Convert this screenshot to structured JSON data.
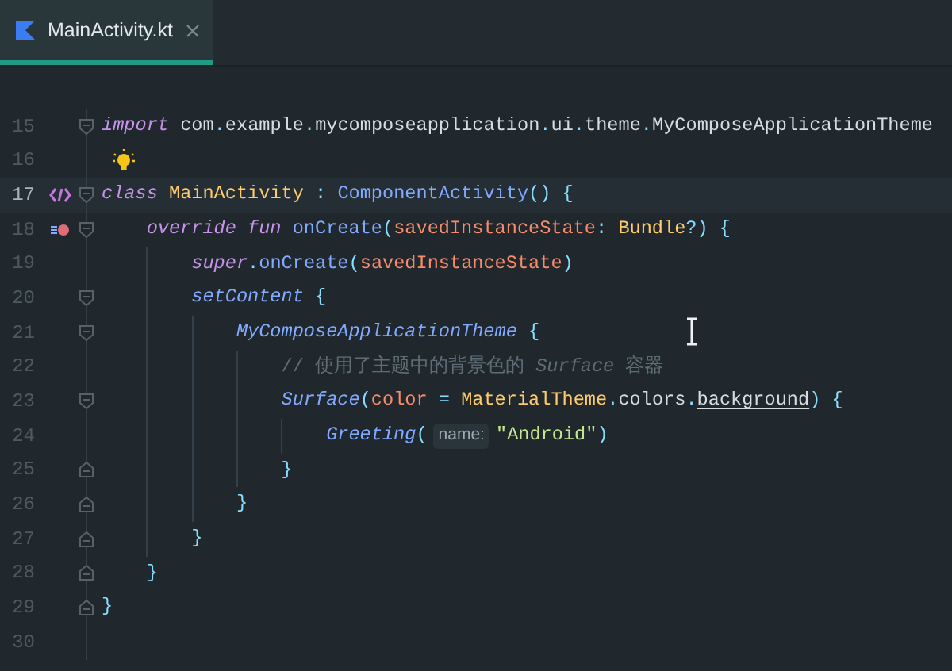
{
  "tabs": [
    {
      "label": "MainActivity.kt",
      "selected": true
    }
  ],
  "lines": [
    {
      "number": "15",
      "current": false,
      "fold": {
        "kind": "start"
      },
      "tokens": [
        {
          "kind": "kw",
          "text": "import"
        },
        {
          "kind": "plain",
          "text": " com"
        },
        {
          "kind": "punct",
          "text": "."
        },
        {
          "kind": "plain",
          "text": "example"
        },
        {
          "kind": "punct",
          "text": "."
        },
        {
          "kind": "plain",
          "text": "mycomposeapplication"
        },
        {
          "kind": "punct",
          "text": "."
        },
        {
          "kind": "plain",
          "text": "ui"
        },
        {
          "kind": "punct",
          "text": "."
        },
        {
          "kind": "plain",
          "text": "theme"
        },
        {
          "kind": "punct",
          "text": "."
        },
        {
          "kind": "plain",
          "text": "MyComposeApplicationTheme"
        }
      ]
    },
    {
      "number": "16",
      "current": false,
      "marker": {
        "kind": "bulb"
      }
    },
    {
      "number": "17",
      "current": true,
      "fold": {
        "kind": "start"
      },
      "marker": {
        "kind": "implemented"
      },
      "tokens": [
        {
          "kind": "kw",
          "text": "class"
        },
        {
          "kind": "cls",
          "text": " MainActivity"
        },
        {
          "kind": "punct",
          "text": " :"
        },
        {
          "kind": "type",
          "text": " ComponentActivity"
        },
        {
          "kind": "punct",
          "text": "() {"
        }
      ]
    },
    {
      "number": "18",
      "current": false,
      "fold": {
        "kind": "start"
      },
      "marker": {
        "kind": "override"
      },
      "tokens": [
        {
          "kind": "kw",
          "text": "    override fun"
        },
        {
          "kind": "fn",
          "text": " onCreate"
        },
        {
          "kind": "punct",
          "text": "("
        },
        {
          "kind": "param",
          "text": "savedInstanceState"
        },
        {
          "kind": "punct",
          "text": ":"
        },
        {
          "kind": "cls",
          "text": " Bundle"
        },
        {
          "kind": "punct",
          "text": "?) {"
        }
      ]
    },
    {
      "number": "19",
      "current": false,
      "tokens": [
        {
          "kind": "kw",
          "text": "        super"
        },
        {
          "kind": "punct",
          "text": "."
        },
        {
          "kind": "fn",
          "text": "onCreate"
        },
        {
          "kind": "punct",
          "text": "("
        },
        {
          "kind": "param",
          "text": "savedInstanceState"
        },
        {
          "kind": "punct",
          "text": ")"
        }
      ]
    },
    {
      "number": "20",
      "current": false,
      "fold": {
        "kind": "start"
      },
      "tokens": [
        {
          "kind": "call",
          "text": "        setContent"
        },
        {
          "kind": "punct",
          "text": " {"
        }
      ]
    },
    {
      "number": "21",
      "current": false,
      "fold": {
        "kind": "start"
      },
      "tokens": [
        {
          "kind": "call",
          "text": "            MyComposeApplicationTheme"
        },
        {
          "kind": "punct",
          "text": " {"
        }
      ]
    },
    {
      "number": "22",
      "current": false,
      "tokens": [
        {
          "kind": "comment",
          "text": "                // 使用了主题中的背景色的 *Surface* 容器"
        }
      ]
    },
    {
      "number": "23",
      "current": false,
      "fold": {
        "kind": "start"
      },
      "tokens": [
        {
          "kind": "call",
          "text": "                Surface"
        },
        {
          "kind": "punct",
          "text": "("
        },
        {
          "kind": "param",
          "text": "color"
        },
        {
          "kind": "punct",
          "text": " ="
        },
        {
          "kind": "cls",
          "text": " MaterialTheme"
        },
        {
          "kind": "punct",
          "text": "."
        },
        {
          "kind": "plain",
          "text": "colors"
        },
        {
          "kind": "punct",
          "text": "."
        },
        {
          "kind": "prop",
          "text": "background"
        },
        {
          "kind": "punct",
          "text": ") {"
        }
      ]
    },
    {
      "number": "24",
      "current": false,
      "tokens": [
        {
          "kind": "call",
          "text": "                    Greeting"
        },
        {
          "kind": "punct",
          "text": "("
        },
        {
          "kind": "hint",
          "text": "name:"
        },
        {
          "kind": "string",
          "text": "\"Android\""
        },
        {
          "kind": "punct",
          "text": ")"
        }
      ]
    },
    {
      "number": "25",
      "current": false,
      "fold": {
        "kind": "end"
      },
      "tokens": [
        {
          "kind": "punct",
          "text": "                }"
        }
      ]
    },
    {
      "number": "26",
      "current": false,
      "fold": {
        "kind": "end"
      },
      "tokens": [
        {
          "kind": "punct",
          "text": "            }"
        }
      ]
    },
    {
      "number": "27",
      "current": false,
      "fold": {
        "kind": "end"
      },
      "tokens": [
        {
          "kind": "punct",
          "text": "        }"
        }
      ]
    },
    {
      "number": "28",
      "current": false,
      "fold": {
        "kind": "end"
      },
      "tokens": [
        {
          "kind": "punct",
          "text": "    }"
        }
      ]
    },
    {
      "number": "29",
      "current": false,
      "fold": {
        "kind": "end"
      },
      "tokens": [
        {
          "kind": "punct",
          "text": "}"
        }
      ]
    },
    {
      "number": "30",
      "current": false
    }
  ]
}
